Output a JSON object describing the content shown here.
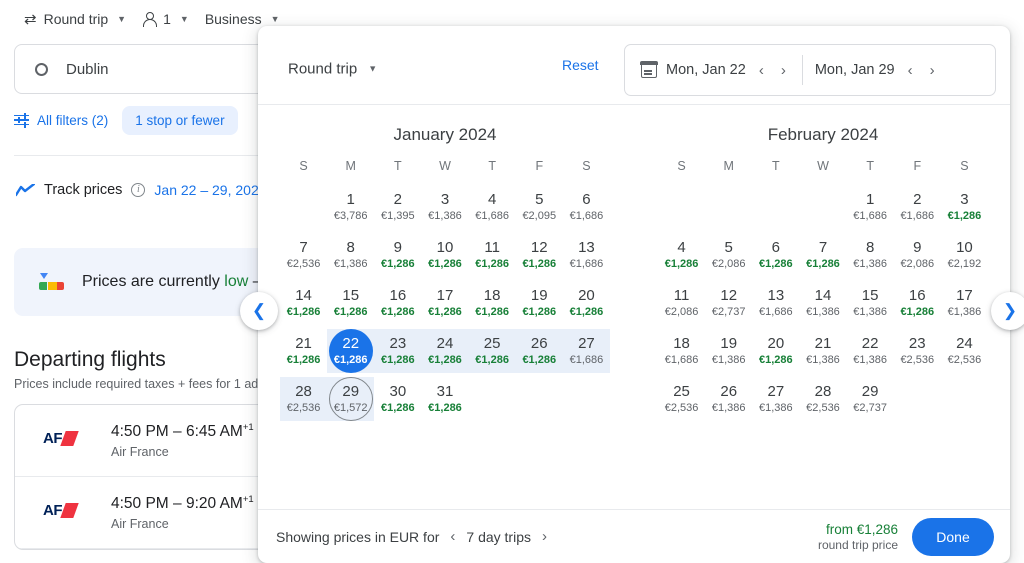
{
  "topbar": {
    "trip_type": "Round trip",
    "passengers": "1",
    "cabin": "Business",
    "swap_icon": "swap-horizontal-icon",
    "person_icon": "person-icon"
  },
  "search": {
    "origin": "Dublin",
    "origin_icon": "circle-outline-icon"
  },
  "filters": {
    "all_filters_label": "All filters (2)",
    "tune_icon": "tune-icon",
    "chip_label": "1 stop or fewer"
  },
  "track": {
    "label": "Track prices",
    "info_icon": "info-icon",
    "trend_icon": "trend-line-icon",
    "dates": "Jan 22 – 29, 202"
  },
  "banner": {
    "gauge_icon": "price-gauge-icon",
    "text_plain": "Prices are currently ",
    "text_green": "low",
    "text_tail": " –"
  },
  "departing": {
    "title": "Departing flights",
    "subtitle": "Prices include required taxes + fees for 1 adul",
    "flights": [
      {
        "logo": "air-france-logo",
        "times": "4:50 PM – 6:45 AM",
        "plus": "+1",
        "airline": "Air France"
      },
      {
        "logo": "air-france-logo",
        "times": "4:50 PM – 9:20 AM",
        "plus": "+1",
        "airline": "Air France"
      }
    ]
  },
  "calendar": {
    "trip_type": "Round trip",
    "reset_label": "Reset",
    "calendar_icon": "calendar-icon",
    "depart_date": "Mon, Jan 22",
    "return_date": "Mon, Jan 29",
    "prev_arrow": "chevron-left-icon",
    "next_arrow": "chevron-right-icon",
    "dow": [
      "S",
      "M",
      "T",
      "W",
      "T",
      "F",
      "S"
    ],
    "nav_prev_icon": "chevron-left-icon",
    "nav_next_icon": "chevron-right-icon",
    "months": [
      {
        "title": "January 2024",
        "lead_blank": 1,
        "days": [
          {
            "d": "1",
            "p": "€3,786",
            "cheap": false
          },
          {
            "d": "2",
            "p": "€1,395",
            "cheap": false
          },
          {
            "d": "3",
            "p": "€1,386",
            "cheap": false
          },
          {
            "d": "4",
            "p": "€1,686",
            "cheap": false
          },
          {
            "d": "5",
            "p": "€2,095",
            "cheap": false
          },
          {
            "d": "6",
            "p": "€1,686",
            "cheap": false
          },
          {
            "d": "7",
            "p": "€2,536",
            "cheap": false
          },
          {
            "d": "8",
            "p": "€1,386",
            "cheap": false
          },
          {
            "d": "9",
            "p": "€1,286",
            "cheap": true
          },
          {
            "d": "10",
            "p": "€1,286",
            "cheap": true
          },
          {
            "d": "11",
            "p": "€1,286",
            "cheap": true
          },
          {
            "d": "12",
            "p": "€1,286",
            "cheap": true
          },
          {
            "d": "13",
            "p": "€1,686",
            "cheap": false
          },
          {
            "d": "14",
            "p": "€1,286",
            "cheap": true
          },
          {
            "d": "15",
            "p": "€1,286",
            "cheap": true
          },
          {
            "d": "16",
            "p": "€1,286",
            "cheap": true
          },
          {
            "d": "17",
            "p": "€1,286",
            "cheap": true
          },
          {
            "d": "18",
            "p": "€1,286",
            "cheap": true
          },
          {
            "d": "19",
            "p": "€1,286",
            "cheap": true
          },
          {
            "d": "20",
            "p": "€1,286",
            "cheap": true
          },
          {
            "d": "21",
            "p": "€1,286",
            "cheap": true
          },
          {
            "d": "22",
            "p": "€1,286",
            "cheap": true,
            "selected": true
          },
          {
            "d": "23",
            "p": "€1,286",
            "cheap": true
          },
          {
            "d": "24",
            "p": "€1,286",
            "cheap": true
          },
          {
            "d": "25",
            "p": "€1,286",
            "cheap": true
          },
          {
            "d": "26",
            "p": "€1,286",
            "cheap": true
          },
          {
            "d": "27",
            "p": "€1,686",
            "cheap": false
          },
          {
            "d": "28",
            "p": "€2,536",
            "cheap": false
          },
          {
            "d": "29",
            "p": "€1,572",
            "cheap": false,
            "return": true
          },
          {
            "d": "30",
            "p": "€1,286",
            "cheap": true
          },
          {
            "d": "31",
            "p": "€1,286",
            "cheap": true
          }
        ]
      },
      {
        "title": "February 2024",
        "lead_blank": 4,
        "days": [
          {
            "d": "1",
            "p": "€1,686",
            "cheap": false
          },
          {
            "d": "2",
            "p": "€1,686",
            "cheap": false
          },
          {
            "d": "3",
            "p": "€1,286",
            "cheap": true
          },
          {
            "d": "4",
            "p": "€1,286",
            "cheap": true
          },
          {
            "d": "5",
            "p": "€2,086",
            "cheap": false
          },
          {
            "d": "6",
            "p": "€1,286",
            "cheap": true
          },
          {
            "d": "7",
            "p": "€1,286",
            "cheap": true
          },
          {
            "d": "8",
            "p": "€1,386",
            "cheap": false
          },
          {
            "d": "9",
            "p": "€2,086",
            "cheap": false
          },
          {
            "d": "10",
            "p": "€2,192",
            "cheap": false
          },
          {
            "d": "11",
            "p": "€2,086",
            "cheap": false
          },
          {
            "d": "12",
            "p": "€2,737",
            "cheap": false
          },
          {
            "d": "13",
            "p": "€1,686",
            "cheap": false
          },
          {
            "d": "14",
            "p": "€1,386",
            "cheap": false
          },
          {
            "d": "15",
            "p": "€1,386",
            "cheap": false
          },
          {
            "d": "16",
            "p": "€1,286",
            "cheap": true
          },
          {
            "d": "17",
            "p": "€1,386",
            "cheap": false
          },
          {
            "d": "18",
            "p": "€1,686",
            "cheap": false
          },
          {
            "d": "19",
            "p": "€1,386",
            "cheap": false
          },
          {
            "d": "20",
            "p": "€1,286",
            "cheap": true
          },
          {
            "d": "21",
            "p": "€1,386",
            "cheap": false
          },
          {
            "d": "22",
            "p": "€1,386",
            "cheap": false
          },
          {
            "d": "23",
            "p": "€2,536",
            "cheap": false
          },
          {
            "d": "24",
            "p": "€2,536",
            "cheap": false
          },
          {
            "d": "25",
            "p": "€2,536",
            "cheap": false
          },
          {
            "d": "26",
            "p": "€1,386",
            "cheap": false
          },
          {
            "d": "27",
            "p": "€1,386",
            "cheap": false
          },
          {
            "d": "28",
            "p": "€2,536",
            "cheap": false
          },
          {
            "d": "29",
            "p": "€2,737",
            "cheap": false
          }
        ]
      }
    ],
    "footer": {
      "showing_label": "Showing prices in EUR for",
      "prev_icon": "chevron-left-icon",
      "trip_length": "7 day trips",
      "next_icon": "chevron-right-icon",
      "from_price": "from €1,286",
      "price_caption": "round trip price",
      "done_label": "Done"
    }
  },
  "colors": {
    "accent": "#1a73e8",
    "cheap_green": "#188038",
    "range_highlight": "#e8eff9",
    "text_primary": "#202124",
    "text_secondary": "#5f6368"
  }
}
